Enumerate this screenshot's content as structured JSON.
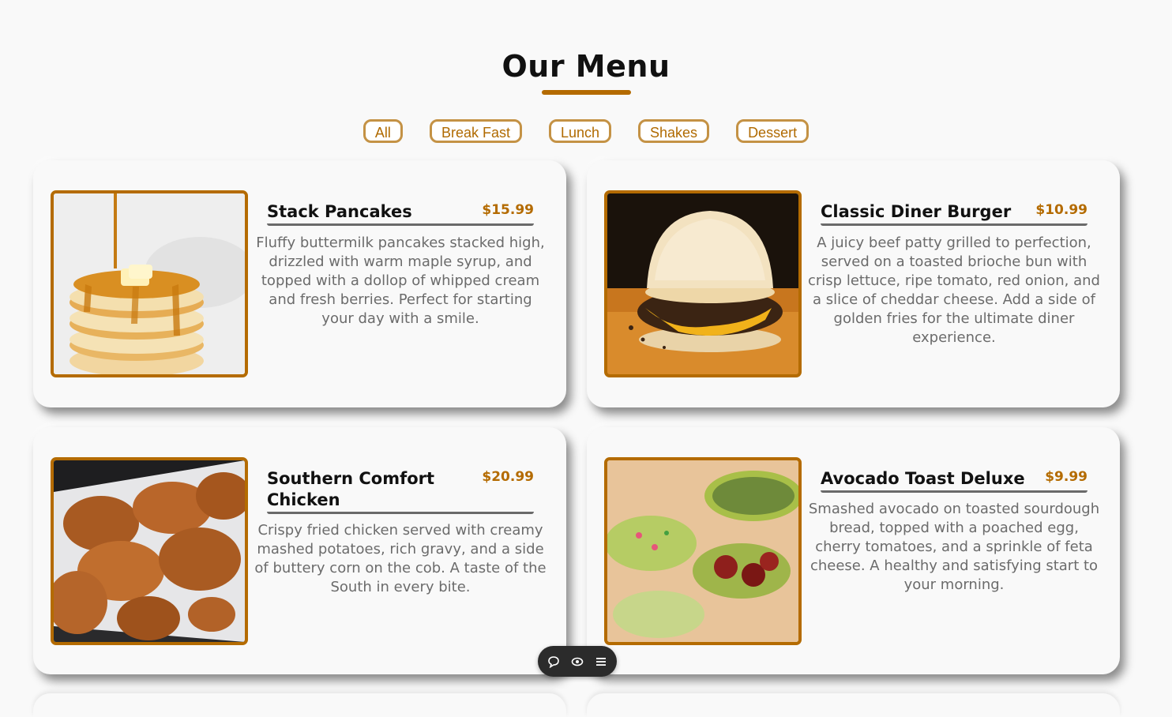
{
  "header": {
    "title": "Our Menu"
  },
  "filters": [
    "All",
    "Break Fast",
    "Lunch",
    "Shakes",
    "Dessert"
  ],
  "colors": {
    "accent": "#b46b00",
    "filter_border": "#c49245",
    "text_muted": "#6b6b6b",
    "background": "#f9f9f9"
  },
  "items": [
    {
      "name": "Stack Pancakes",
      "price": "$15.99",
      "description": "Fluffy buttermilk pancakes stacked high, drizzled with warm maple syrup, and topped with a dollop of whipped cream and fresh berries. Perfect for starting your day with a smile."
    },
    {
      "name": "Classic Diner Burger",
      "price": "$10.99",
      "description": "A juicy beef patty grilled to perfection, served on a toasted brioche bun with crisp lettuce, ripe tomato, red onion, and a slice of cheddar cheese. Add a side of golden fries for the ultimate diner experience."
    },
    {
      "name": "Southern Comfort Chicken",
      "price": "$20.99",
      "description": "Crispy fried chicken served with creamy mashed potatoes, rich gravy, and a side of buttery corn on the cob. A taste of the South in every bite."
    },
    {
      "name": "Avocado Toast Deluxe",
      "price": "$9.99",
      "description": "Smashed avocado on toasted sourdough bread, topped with a poached egg, cherry tomatoes, and a sprinkle of feta cheese. A healthy and satisfying start to your morning."
    }
  ],
  "dock": {
    "icons": [
      "comment-icon",
      "eye-icon",
      "menu-icon"
    ]
  }
}
